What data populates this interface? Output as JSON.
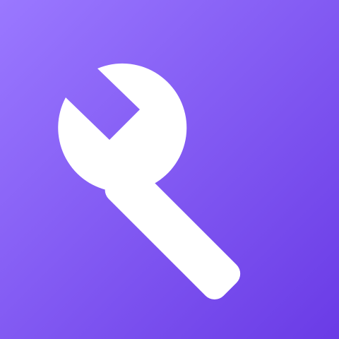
{
  "icon": {
    "name": "wrench-icon",
    "background_start": "#9a78ff",
    "background_end": "#6a3be6",
    "glyph_color": "#ffffff"
  }
}
